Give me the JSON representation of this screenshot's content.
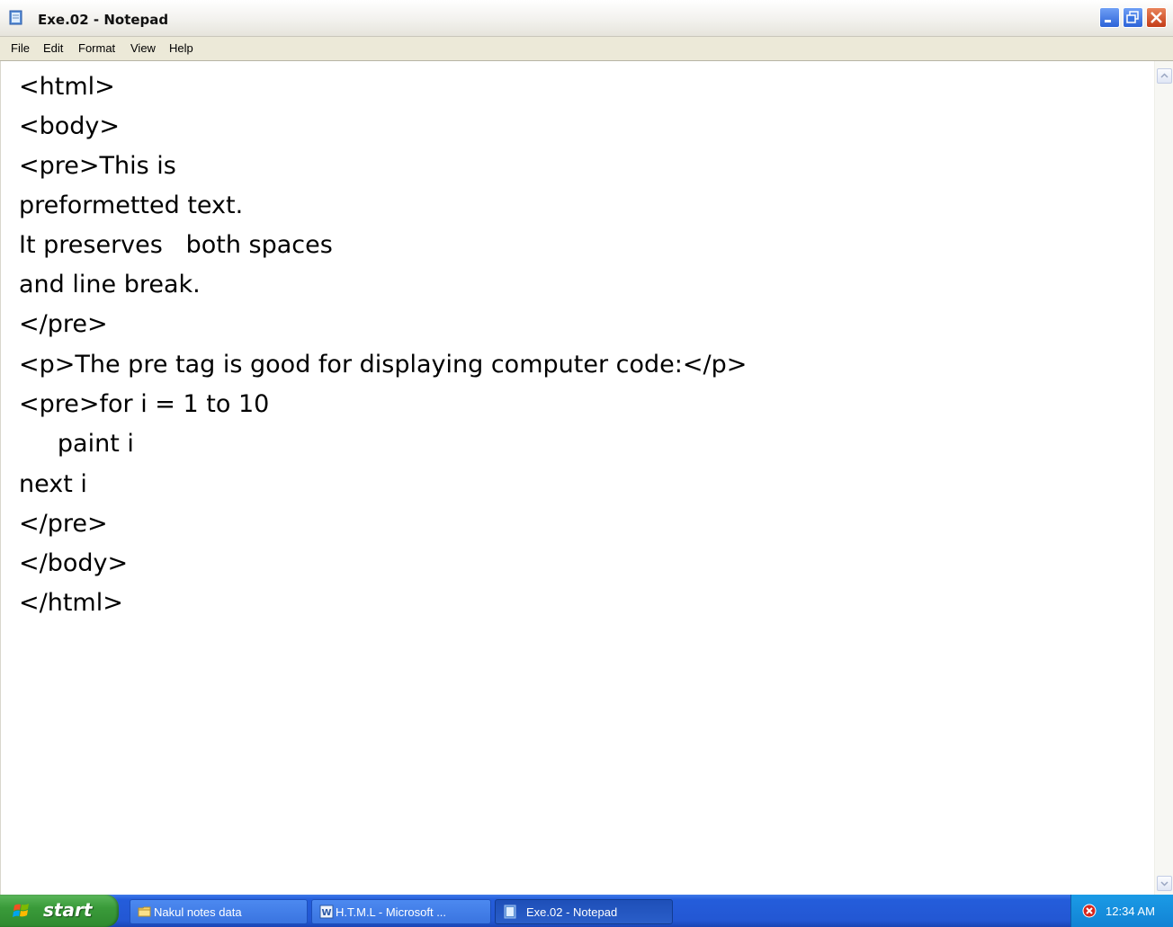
{
  "window": {
    "title": "Exe.02 - Notepad"
  },
  "menubar": {
    "items": [
      "File",
      "Edit",
      "Format",
      "View",
      "Help"
    ]
  },
  "editor": {
    "lines": [
      "<html>",
      "<body>",
      "<pre>This is",
      "preformetted text.",
      "It preserves   both spaces",
      "and line break.",
      "</pre>",
      "<p>The pre tag is good for displaying computer code:</p>",
      "<pre>for i = 1 to 10",
      "     paint i",
      "next i",
      "</pre>",
      "</body>",
      "</html>"
    ]
  },
  "taskbar": {
    "start_label": "start",
    "tasks": [
      {
        "label": "Nakul notes data",
        "icon": "folder-icon"
      },
      {
        "label": "H.T.M.L - Microsoft ...",
        "icon": "word-icon"
      },
      {
        "label": "Exe.02 - Notepad",
        "icon": "notepad-icon"
      }
    ],
    "clock": "12:34 AM",
    "tray_icon": "security-shield-icon"
  },
  "colors": {
    "taskbar_blue": "#245ddb",
    "start_green": "#3a9b3a",
    "close_red": "#c43c17",
    "menubar_bg": "#ece9d8"
  }
}
